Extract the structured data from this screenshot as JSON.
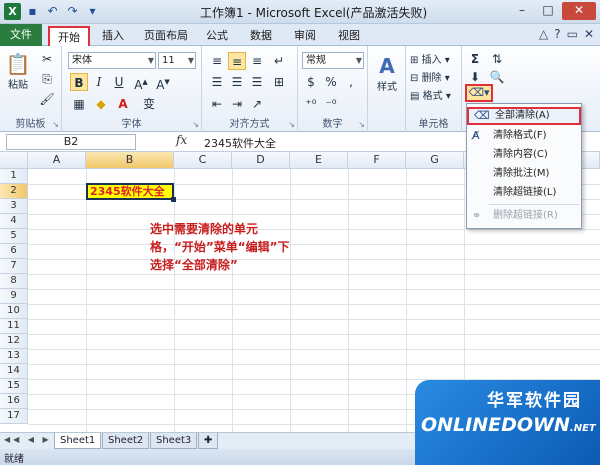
{
  "window": {
    "title": "工作簿1 - Microsoft Excel(产品激活失败)",
    "min": "–",
    "max": "□",
    "close": "✕"
  },
  "tabs": {
    "file": "文件",
    "items": [
      "开始",
      "插入",
      "页面布局",
      "公式",
      "数据",
      "审阅",
      "视图"
    ]
  },
  "ribbon": {
    "clipboard": {
      "label": "剪贴板",
      "paste": "粘贴"
    },
    "font": {
      "label": "字体",
      "name": "宋体",
      "size": "11",
      "bold": "B",
      "italic": "I",
      "underline": "U"
    },
    "alignment": {
      "label": "对齐方式"
    },
    "number": {
      "label": "数字",
      "format": "常规",
      "percent": "%",
      "comma": ",",
      "currency": "$"
    },
    "styles": {
      "label": "样式",
      "button": "样式"
    },
    "cells": {
      "label": "单元格",
      "insert": "插入",
      "delete": "删除",
      "format": "格式"
    },
    "editing": {
      "sum": "Σ"
    }
  },
  "formula_bar": {
    "name_box": "B2",
    "fx": "fx",
    "content": "2345软件大全"
  },
  "sheet": {
    "columns": [
      "A",
      "B",
      "C",
      "D",
      "E",
      "F",
      "G"
    ],
    "rows": [
      "1",
      "2",
      "3",
      "4",
      "5",
      "6",
      "7",
      "8",
      "9",
      "10",
      "11",
      "12",
      "13",
      "14",
      "15",
      "16",
      "17"
    ],
    "selected_col": "B",
    "selected_row": "2",
    "cell_b2": "2345软件大全"
  },
  "annotation": "选中需要清除的单元格，“开始”菜单“编辑”下选择“全部清除”",
  "clear_menu": {
    "items": [
      {
        "label": "全部清除(A)",
        "highlighted": true,
        "disabled": false
      },
      {
        "label": "清除格式(F)",
        "highlighted": false,
        "disabled": false
      },
      {
        "label": "清除内容(C)",
        "highlighted": false,
        "disabled": false
      },
      {
        "label": "清除批注(M)",
        "highlighted": false,
        "disabled": false
      },
      {
        "label": "清除超链接(L)",
        "highlighted": false,
        "disabled": false
      },
      {
        "label": "删除超链接(R)",
        "highlighted": false,
        "disabled": true
      }
    ]
  },
  "sheet_tabs": [
    "Sheet1",
    "Sheet2",
    "Sheet3"
  ],
  "status": {
    "text": "就绪"
  },
  "watermark": {
    "cn": "华军软件园",
    "brand": "ONLINEDOWN",
    "suffix": ".NET"
  },
  "colors": {
    "accent_red": "#e0303a",
    "file_tab": "#2a7d3f",
    "cell_fill": "#ffff00",
    "cell_text": "#e0202a"
  }
}
